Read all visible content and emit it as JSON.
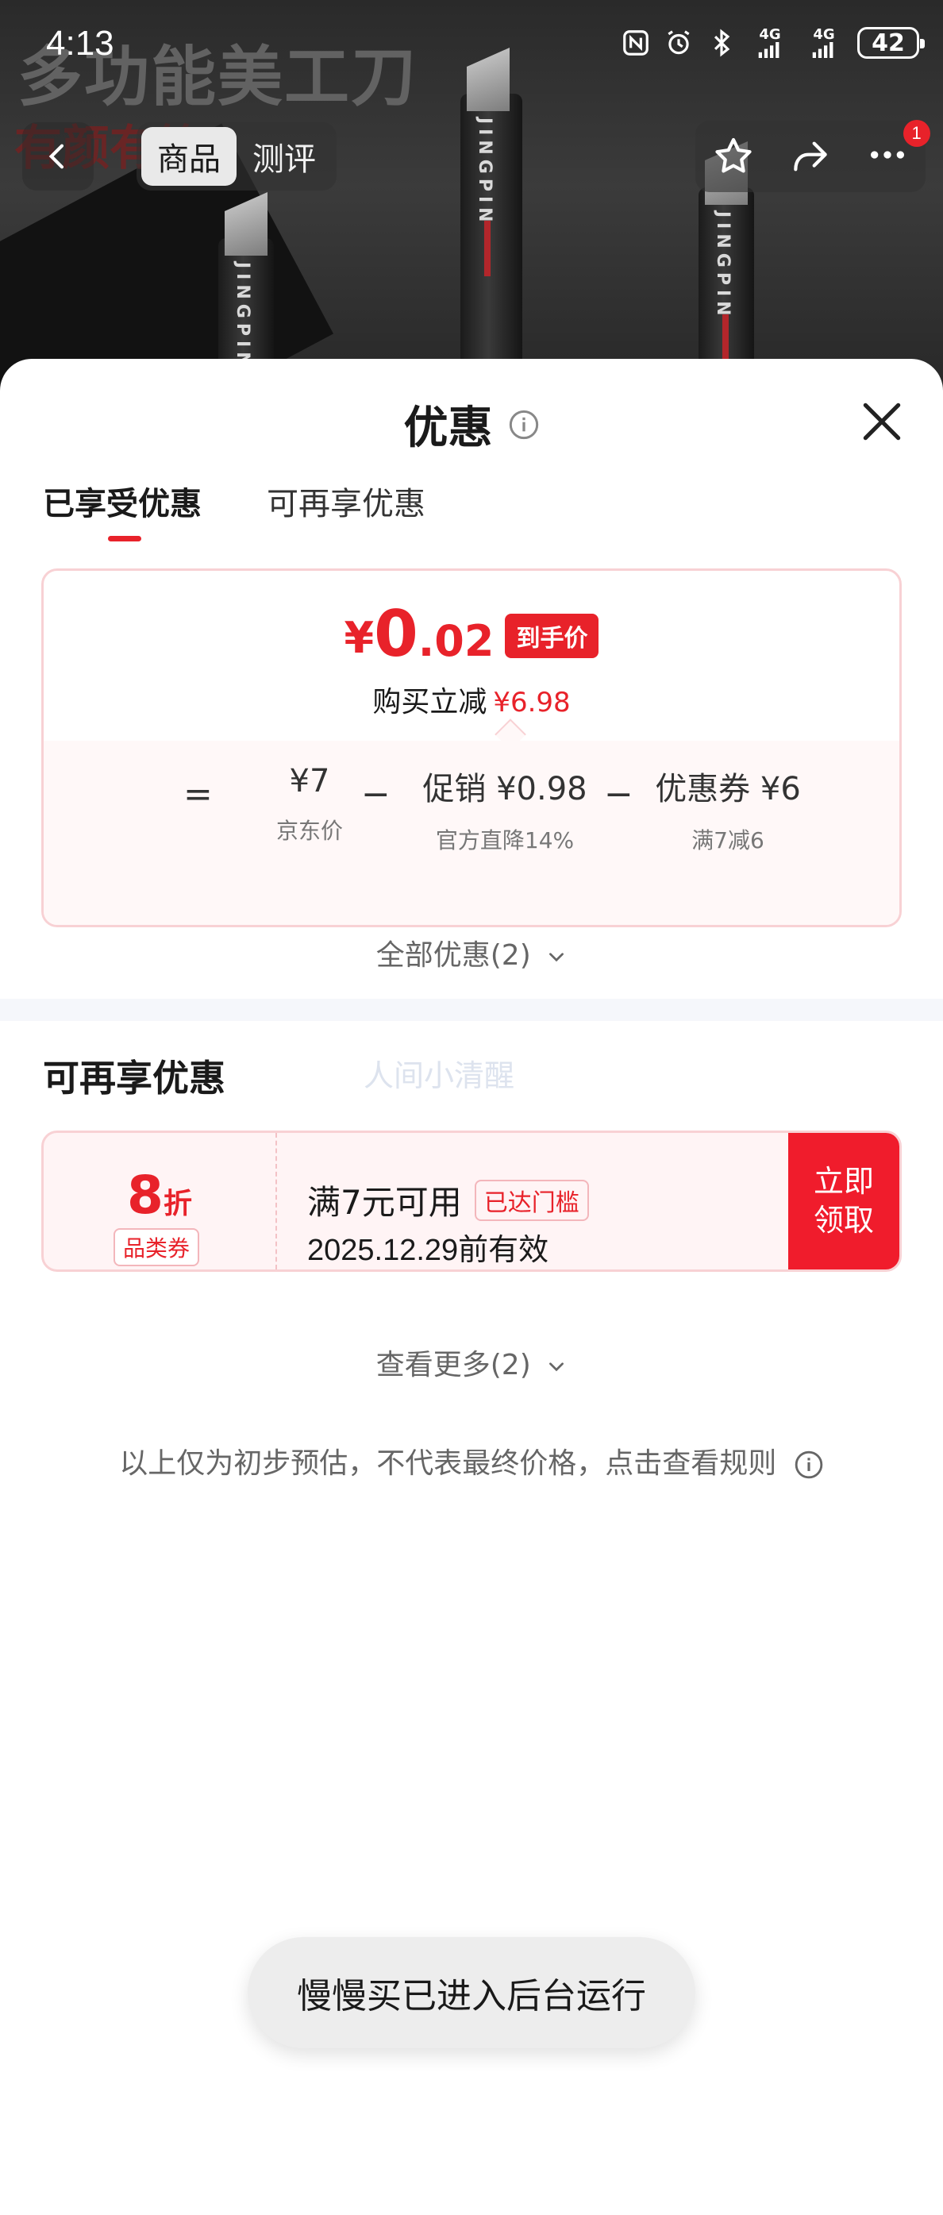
{
  "status_bar": {
    "time": "4:13",
    "network_1": "4G",
    "network_2": "4G",
    "battery": "42"
  },
  "background": {
    "headline": "多功能美工刀",
    "slogan": "有颜有範",
    "knife_brand": "JINGPIN"
  },
  "nav": {
    "tabs": [
      {
        "label": "商品",
        "active": true
      },
      {
        "label": "测评",
        "active": false
      }
    ],
    "more_badge": "1"
  },
  "sheet": {
    "title": "优惠",
    "tabs": [
      {
        "label": "已享受优惠",
        "active": true
      },
      {
        "label": "可再享优惠",
        "active": false
      }
    ],
    "summary": {
      "yen": "¥",
      "final_int": "0",
      "final_dec": ".02",
      "final_tag": "到手价",
      "cut_label": "购买立减",
      "cut_amount": "¥6.98",
      "equals": "=",
      "minus": "−",
      "base_price": "¥7",
      "base_label": "京东价",
      "promo_price": "促销 ¥0.98",
      "promo_label": "官方直降14%",
      "coupon_price": "优惠券 ¥6",
      "coupon_label": "满7减6"
    },
    "all_offers": "全部优惠(2)",
    "section_title": "可再享优惠",
    "watermark": "人间小清醒",
    "coupon": {
      "discount": "8",
      "unit": "折",
      "category": "品类券",
      "condition": "满7元可用",
      "threshold": "已达门槛",
      "expiry": "2025.12.29前有效",
      "claim": "立即领取"
    },
    "see_more": "查看更多(2)",
    "disclaimer": "以上仅为初步预估，不代表最终价格，点击查看规则"
  },
  "toast": "慢慢买已进入后台运行",
  "colors": {
    "accent": "#e8222a",
    "claim_bg": "#f01c2c",
    "card_border": "#f8d1d4",
    "card_bg": "#fff8f8"
  }
}
